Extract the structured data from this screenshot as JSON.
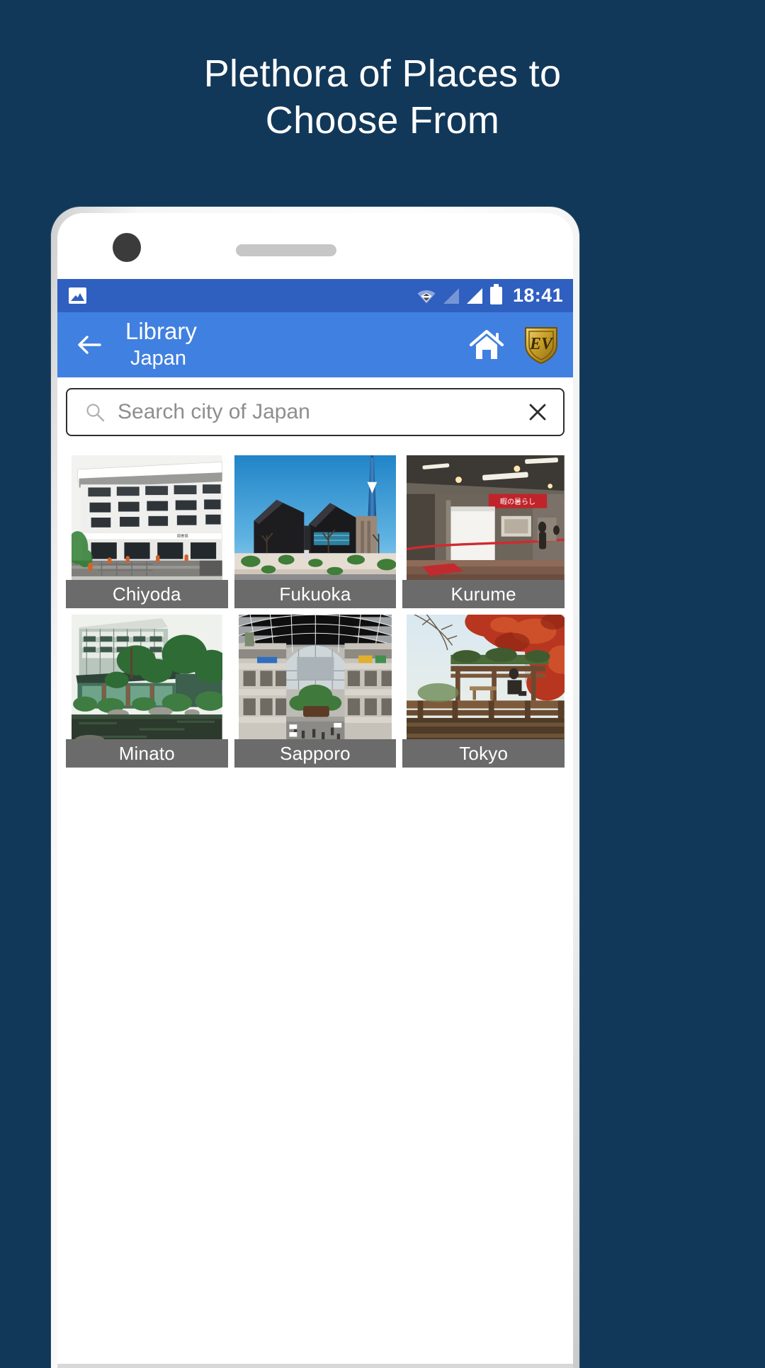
{
  "promo": {
    "line1": "Plethora of Places to",
    "line2": "Choose From"
  },
  "colors": {
    "background": "#123859",
    "status_bar": "#2f5fbf",
    "app_bar": "#4080e0",
    "label_overlay": "#6b6b6b",
    "accent_badge": "#d9a41c"
  },
  "status_bar": {
    "image_icon": "image-icon",
    "wifi_icon": "wifi-icon",
    "signal_empty_icon": "signal-empty-icon",
    "signal_full_icon": "signal-full-icon",
    "battery_icon": "battery-icon",
    "time": "18:41"
  },
  "app_bar": {
    "back_icon": "back-arrow-icon",
    "title": "Library",
    "subtitle": "Japan",
    "home_icon": "home-icon",
    "badge_icon": "ev-shield-icon",
    "badge_text": "EV"
  },
  "search": {
    "search_icon": "search-icon",
    "placeholder": "Search city of Japan",
    "value": "",
    "clear_icon": "close-icon"
  },
  "grid": {
    "cards": [
      {
        "label": "Chiyoda",
        "photo": "chiyoda-library-building"
      },
      {
        "label": "Fukuoka",
        "photo": "fukuoka-museum-tower"
      },
      {
        "label": "Kurume",
        "photo": "kurume-exhibition-hall"
      },
      {
        "label": "Minato",
        "photo": "minato-garden-pond"
      },
      {
        "label": "Sapporo",
        "photo": "sapporo-atrium-mall"
      },
      {
        "label": "Tokyo",
        "photo": "tokyo-autumn-maple"
      }
    ]
  }
}
